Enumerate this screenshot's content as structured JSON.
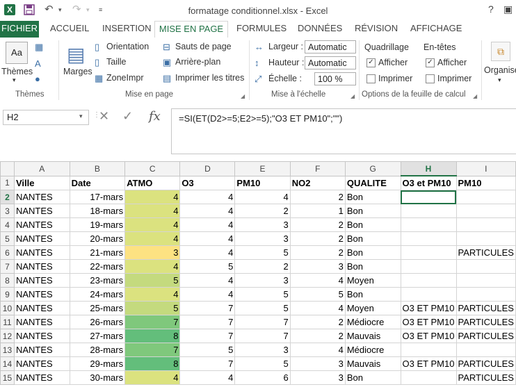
{
  "titlebar": {
    "app_icon": "X",
    "title": "formatage conditionnel.xlsx - Excel",
    "help": "?"
  },
  "tabs": [
    "FICHIER",
    "ACCUEIL",
    "INSERTION",
    "MISE EN PAGE",
    "FORMULES",
    "DONNÉES",
    "RÉVISION",
    "AFFICHAGE"
  ],
  "ribbon": {
    "themes": {
      "btn": "Thèmes",
      "group": "Thèmes"
    },
    "mise_en_page": {
      "marges": "Marges",
      "orientation": "Orientation",
      "taille": "Taille",
      "zone": "ZoneImpr",
      "sauts": "Sauts de page",
      "arriere": "Arrière-plan",
      "imprimer_titres": "Imprimer les titres",
      "group": "Mise en page"
    },
    "echelle": {
      "largeur_label": "Largeur :",
      "largeur_value": "Automatic",
      "hauteur_label": "Hauteur :",
      "hauteur_value": "Automatic",
      "echelle_label": "Échelle :",
      "echelle_value": "100 %",
      "group": "Mise à l'échelle"
    },
    "options": {
      "quadrillage": "Quadrillage",
      "entetes": "En-têtes",
      "afficher": "Afficher",
      "imprimer": "Imprimer",
      "group": "Options de la feuille de calcul"
    },
    "organiser": "Organiser"
  },
  "formula_bar": {
    "name_box": "H2",
    "formula": "=SI(ET(D2>=5;E2>=5);\"O3 ET PM10\";\"\")"
  },
  "sheet": {
    "columns": [
      "A",
      "B",
      "C",
      "D",
      "E",
      "F",
      "G",
      "H",
      "I"
    ],
    "selected_column": "H",
    "selected_row": "2",
    "header_row": [
      "Ville",
      "Date",
      "ATMO",
      "O3",
      "PM10",
      "NO2",
      "QUALITE",
      "O3 et PM10",
      "PM10"
    ],
    "rows": [
      {
        "n": "2",
        "ville": "NANTES",
        "date": "17-mars",
        "atmo": "4",
        "o3": "4",
        "pm10": "4",
        "no2": "2",
        "qualite": "Bon",
        "o3pm10": "",
        "pm": "",
        "atmo_color": "#dbe27f"
      },
      {
        "n": "3",
        "ville": "NANTES",
        "date": "18-mars",
        "atmo": "4",
        "o3": "4",
        "pm10": "2",
        "no2": "1",
        "qualite": "Bon",
        "o3pm10": "",
        "pm": "",
        "atmo_color": "#dbe27f"
      },
      {
        "n": "4",
        "ville": "NANTES",
        "date": "19-mars",
        "atmo": "4",
        "o3": "4",
        "pm10": "3",
        "no2": "2",
        "qualite": "Bon",
        "o3pm10": "",
        "pm": "",
        "atmo_color": "#dbe27f"
      },
      {
        "n": "5",
        "ville": "NANTES",
        "date": "20-mars",
        "atmo": "4",
        "o3": "4",
        "pm10": "3",
        "no2": "2",
        "qualite": "Bon",
        "o3pm10": "",
        "pm": "",
        "atmo_color": "#dbe27f"
      },
      {
        "n": "6",
        "ville": "NANTES",
        "date": "21-mars",
        "atmo": "3",
        "o3": "4",
        "pm10": "5",
        "no2": "2",
        "qualite": "Bon",
        "o3pm10": "",
        "pm": "PARTICULES",
        "atmo_color": "#fde282"
      },
      {
        "n": "7",
        "ville": "NANTES",
        "date": "22-mars",
        "atmo": "4",
        "o3": "5",
        "pm10": "2",
        "no2": "3",
        "qualite": "Bon",
        "o3pm10": "",
        "pm": "",
        "atmo_color": "#dbe27f"
      },
      {
        "n": "8",
        "ville": "NANTES",
        "date": "23-mars",
        "atmo": "5",
        "o3": "4",
        "pm10": "3",
        "no2": "4",
        "qualite": "Moyen",
        "o3pm10": "",
        "pm": "",
        "atmo_color": "#c4da7e"
      },
      {
        "n": "9",
        "ville": "NANTES",
        "date": "24-mars",
        "atmo": "4",
        "o3": "4",
        "pm10": "5",
        "no2": "5",
        "qualite": "Bon",
        "o3pm10": "",
        "pm": "",
        "atmo_color": "#dbe27f"
      },
      {
        "n": "10",
        "ville": "NANTES",
        "date": "25-mars",
        "atmo": "5",
        "o3": "7",
        "pm10": "5",
        "no2": "4",
        "qualite": "Moyen",
        "o3pm10": "O3 ET PM10",
        "pm": "PARTICULES",
        "atmo_color": "#c4da7e"
      },
      {
        "n": "11",
        "ville": "NANTES",
        "date": "26-mars",
        "atmo": "7",
        "o3": "7",
        "pm10": "7",
        "no2": "2",
        "qualite": "Médiocre",
        "o3pm10": "O3 ET PM10",
        "pm": "PARTICULES",
        "atmo_color": "#7fc87c"
      },
      {
        "n": "12",
        "ville": "NANTES",
        "date": "27-mars",
        "atmo": "8",
        "o3": "7",
        "pm10": "7",
        "no2": "2",
        "qualite": "Mauvais",
        "o3pm10": "O3 ET PM10",
        "pm": "PARTICULES",
        "atmo_color": "#63be7b"
      },
      {
        "n": "13",
        "ville": "NANTES",
        "date": "28-mars",
        "atmo": "7",
        "o3": "5",
        "pm10": "3",
        "no2": "4",
        "qualite": "Médiocre",
        "o3pm10": "",
        "pm": "",
        "atmo_color": "#7fc87c"
      },
      {
        "n": "14",
        "ville": "NANTES",
        "date": "29-mars",
        "atmo": "8",
        "o3": "7",
        "pm10": "5",
        "no2": "3",
        "qualite": "Mauvais",
        "o3pm10": "O3 ET PM10",
        "pm": "PARTICULES",
        "atmo_color": "#63be7b"
      },
      {
        "n": "15",
        "ville": "NANTES",
        "date": "30-mars",
        "atmo": "4",
        "o3": "4",
        "pm10": "6",
        "no2": "3",
        "qualite": "Bon",
        "o3pm10": "",
        "pm": "PARTICULES",
        "atmo_color": "#dbe27f"
      }
    ]
  },
  "colors": {
    "accent": "#217346"
  }
}
